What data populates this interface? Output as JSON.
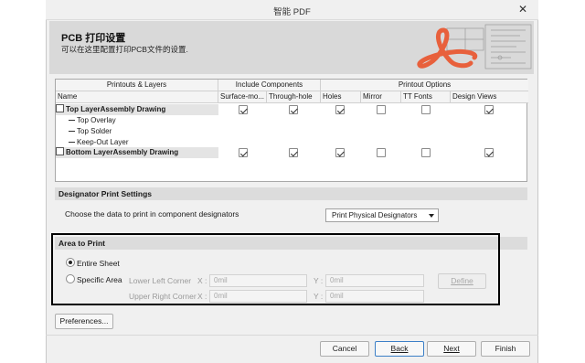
{
  "window": {
    "title": "智能 PDF",
    "close_glyph": "✕"
  },
  "banner": {
    "heading": "PCB 打印设置",
    "subtitle": "可以在这里配置打印PCB文件的设置.",
    "accent_color": "#e8603c"
  },
  "printouts": {
    "groups": [
      "Printouts & Layers",
      "Include Components",
      "Printout Options"
    ],
    "columns": [
      "Name",
      "Surface-mo...",
      "Through-hole",
      "Holes",
      "Mirror",
      "TT Fonts",
      "Design Views"
    ],
    "rows": [
      {
        "name": "Top LayerAssembly Drawing",
        "type": "parent",
        "checks": [
          true,
          true,
          true,
          false,
          false,
          true
        ]
      },
      {
        "name": "Top Overlay",
        "type": "child"
      },
      {
        "name": "Top Solder",
        "type": "child"
      },
      {
        "name": "Keep-Out Layer",
        "type": "child"
      },
      {
        "name": "Bottom LayerAssembly Drawing",
        "type": "parent",
        "checks": [
          true,
          true,
          true,
          false,
          false,
          true
        ]
      }
    ]
  },
  "designator": {
    "section_title": "Designator Print Settings",
    "prompt": "Choose the data to print in component designators",
    "selected": "Print Physical Designators"
  },
  "area": {
    "section_title": "Area to Print",
    "entire_sheet": "Entire Sheet",
    "specific_area": "Specific Area",
    "selected": "Entire Sheet",
    "lower_left_label": "Lower Left Corner",
    "upper_right_label": "Upper Right Corner",
    "x_label": "X :",
    "y_label": "Y :",
    "ll_x": "0mil",
    "ll_y": "0mil",
    "ur_x": "0mil",
    "ur_y": "0mil",
    "define_button": "Define"
  },
  "preferences_button": "Preferences...",
  "footer": {
    "cancel": "Cancel",
    "back": "Back",
    "next": "Next",
    "finish": "Finish"
  }
}
